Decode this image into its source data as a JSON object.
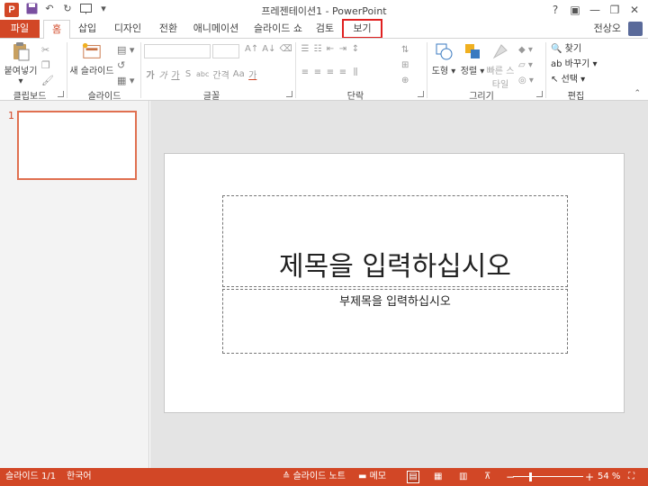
{
  "titlebar": {
    "app_icon": "P",
    "title": "프레젠테이션1 - PowerPoint",
    "help": "?",
    "ribbon_opts": "▣",
    "minimize": "—",
    "restore": "❐",
    "close": "✕"
  },
  "tabs": {
    "file": "파일",
    "items": [
      "홈",
      "삽입",
      "디자인",
      "전환",
      "애니메이션",
      "슬라이드 쇼",
      "검토",
      "보기"
    ],
    "user": "전상오"
  },
  "ribbon": {
    "clipboard": {
      "label": "클립보드",
      "paste": "붙여넣기"
    },
    "slides": {
      "label": "슬라이드",
      "new_slide": "새 슬라이드"
    },
    "font": {
      "label": "글꼴",
      "bold": "가",
      "italic": "가",
      "underline": "가",
      "strike": "S",
      "shadow": "abc",
      "spacing": "간격",
      "case": "Aa",
      "color": "가"
    },
    "paragraph": {
      "label": "단락"
    },
    "drawing": {
      "label": "그리기",
      "shapes": "도형",
      "arrange": "정렬",
      "quick_styles": "빠른 스타일"
    },
    "editing": {
      "label": "편집",
      "find": "찾기",
      "replace": "바꾸기",
      "select": "선택"
    }
  },
  "slides_panel": {
    "slide_number": "1"
  },
  "slide": {
    "title_placeholder": "제목을 입력하십시오",
    "subtitle_placeholder": "부제목을 입력하십시오"
  },
  "status": {
    "slide_info": "슬라이드 1/1",
    "language": "한국어",
    "notes": "슬라이드 노트",
    "comments": "메모",
    "zoom_minus": "−",
    "zoom_plus": "+",
    "zoom": "54 %"
  },
  "colors": {
    "accent": "#d24726",
    "highlight": "#e02020"
  }
}
